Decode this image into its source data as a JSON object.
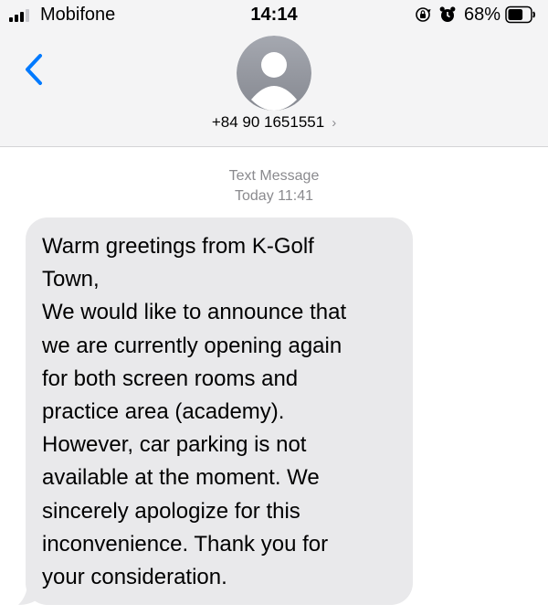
{
  "status_bar": {
    "carrier": "Mobifone",
    "time": "14:14",
    "battery_percent": "68%",
    "battery_level": 0.68,
    "icons": [
      "signal-icon",
      "orientation-lock-icon",
      "alarm-icon",
      "battery-icon"
    ]
  },
  "header": {
    "back_icon": "chevron-left-icon",
    "avatar_icon": "person-icon",
    "contact_number": "+84 90 1651551",
    "contact_chevron": "›"
  },
  "thread": {
    "service_label": "Text Message",
    "timestamp": "Today 11:41"
  },
  "message": {
    "text": "Warm greetings from K-Golf\nTown,\nWe would like to announce that\nwe are currently opening again\nfor both screen rooms and\npractice area (academy).\nHowever, car parking is not\navailable at the moment. We\nsincerely apologize for this\ninconvenience. Thank you for\nyour consideration."
  },
  "colors": {
    "accent": "#007aff",
    "bubble": "#e9e9eb",
    "header_bg": "#f4f4f5",
    "meta_text": "#8a8a8e"
  }
}
